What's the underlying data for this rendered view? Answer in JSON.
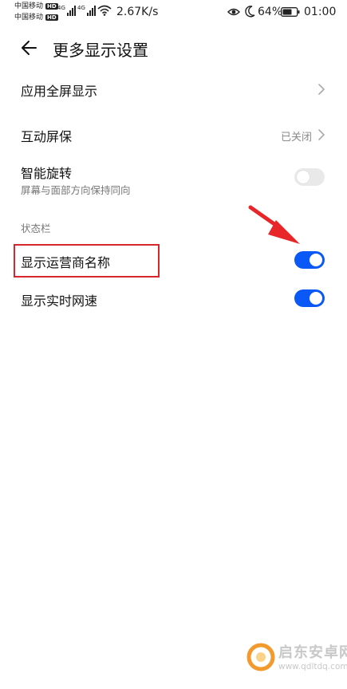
{
  "status_bar": {
    "carrier_1": "中国移动",
    "carrier_2": "中国移动",
    "hd_badge": "HD",
    "signal_tag": "4G",
    "net_speed": "2.67K/s",
    "battery": "64%",
    "time": "01:00",
    "icons": [
      "hd-icon",
      "signal-icon",
      "wifi-icon",
      "eye-comfort-icon",
      "moon-icon",
      "battery-icon"
    ]
  },
  "header": {
    "title": "更多显示设置",
    "back_icon": "arrow-left-icon"
  },
  "settings": {
    "fullscreen": {
      "label": "应用全屏显示",
      "icon": "chevron-right-icon"
    },
    "screensaver": {
      "label": "互动屏保",
      "value": "已关闭",
      "icon": "chevron-right-icon"
    },
    "smart_rotation": {
      "label": "智能旋转",
      "sublabel": "屏幕与面部方向保持同向",
      "enabled": false
    },
    "status_bar_section": "状态栏",
    "show_carrier": {
      "label": "显示运营商名称",
      "enabled": true
    },
    "show_net_speed": {
      "label": "显示实时网速",
      "enabled": true
    }
  },
  "annotations": {
    "highlight_color": "#d9262c",
    "arrow_color": "#e8262a"
  },
  "colors": {
    "accent": "#0a59f7",
    "toggle_off": "#e9e9e9",
    "secondary_text": "#777777"
  },
  "watermark": {
    "name": "启东安卓网",
    "url": "www.qdltdq.com"
  }
}
